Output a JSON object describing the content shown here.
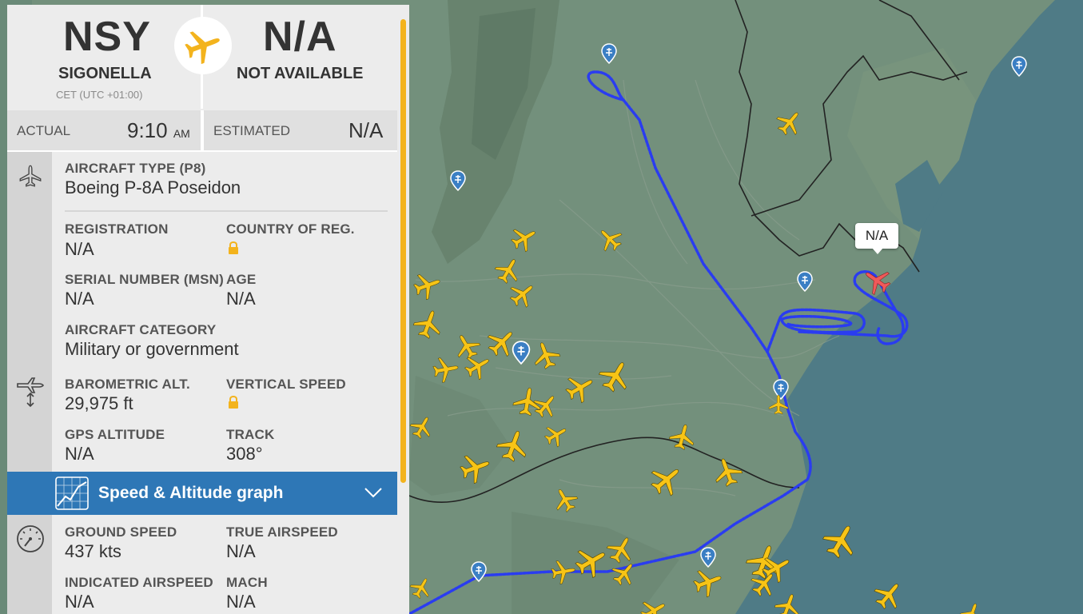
{
  "flight": {
    "origin": {
      "code": "NSY",
      "city": "SIGONELLA",
      "timezone": "CET (UTC +01:00)"
    },
    "destination": {
      "code": "N/A",
      "city": "NOT AVAILABLE"
    },
    "times": {
      "actual_label": "ACTUAL",
      "actual_time": "9:10",
      "actual_ampm": "AM",
      "estimated_label": "ESTIMATED",
      "estimated_value": "N/A"
    }
  },
  "aircraft": {
    "type_label": "AIRCRAFT TYPE",
    "type_code": "(P8)",
    "type_value": "Boeing P-8A Poseidon",
    "registration_label": "REGISTRATION",
    "registration_value": "N/A",
    "country_label": "COUNTRY OF REG.",
    "serial_label": "SERIAL NUMBER (MSN)",
    "serial_value": "N/A",
    "age_label": "AGE",
    "age_value": "N/A",
    "category_label": "AIRCRAFT CATEGORY",
    "category_value": "Military or government"
  },
  "altitude": {
    "baro_label": "BAROMETRIC ALT.",
    "baro_value": "29,975 ft",
    "vspeed_label": "VERTICAL SPEED",
    "gps_label": "GPS ALTITUDE",
    "gps_value": "N/A",
    "track_label": "TRACK",
    "track_value": "308°"
  },
  "graph": {
    "title": "Speed & Altitude graph"
  },
  "speed": {
    "ground_label": "GROUND SPEED",
    "ground_value": "437 kts",
    "true_label": "TRUE AIRSPEED",
    "true_value": "N/A",
    "indicated_label": "INDICATED AIRSPEED",
    "indicated_value": "N/A",
    "mach_label": "MACH",
    "mach_value": "N/A"
  },
  "map": {
    "selected_label": "N/A"
  },
  "icons": {
    "header": "airplane-circle-icon",
    "aircraft": "airplane-icon",
    "altitude": "airplane-altitude-icon",
    "graph": "graph-icon",
    "graph_toggle": "chevron-down-icon",
    "speed": "speedometer-icon",
    "lock": "lock-icon"
  },
  "colors": {
    "accent": "#f3b31d",
    "graph_bar": "#2e77b6",
    "track": "#2a3cf0",
    "selected_plane": "#f05a5a",
    "sea": "#4f7b86"
  }
}
